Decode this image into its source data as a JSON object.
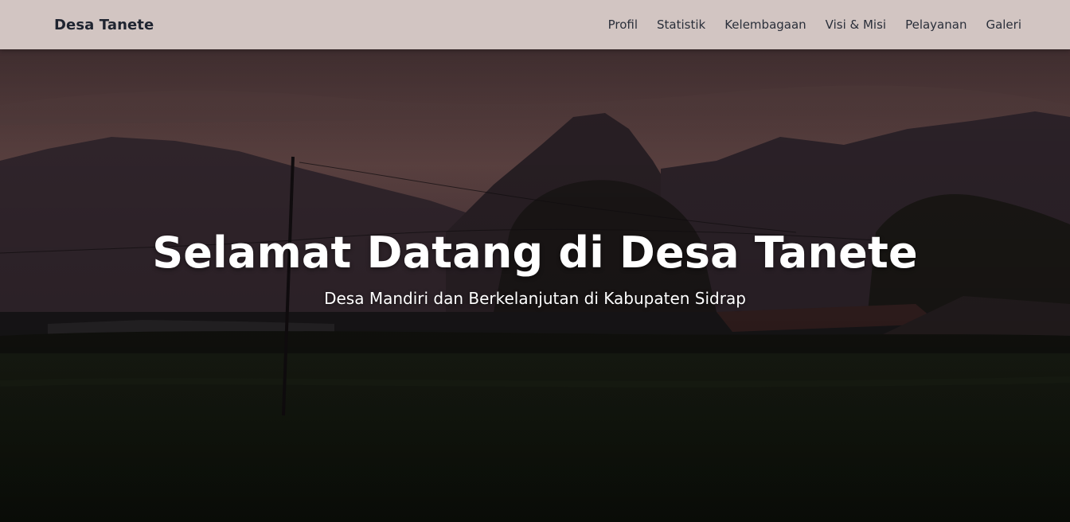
{
  "navbar": {
    "brand": "Desa Tanete",
    "links": [
      {
        "label": "Profil"
      },
      {
        "label": "Statistik"
      },
      {
        "label": "Kelembagaan"
      },
      {
        "label": "Visi & Misi"
      },
      {
        "label": "Pelayanan"
      },
      {
        "label": "Galeri"
      }
    ]
  },
  "hero": {
    "title": "Selamat Datang di Desa Tanete",
    "subtitle": "Desa Mandiri dan Berkelanjutan di Kabupaten Sidrap"
  },
  "colors": {
    "navbar_bg": "#d2c5c2",
    "brand_text": "#1f2430",
    "hero_text": "#ffffff"
  }
}
